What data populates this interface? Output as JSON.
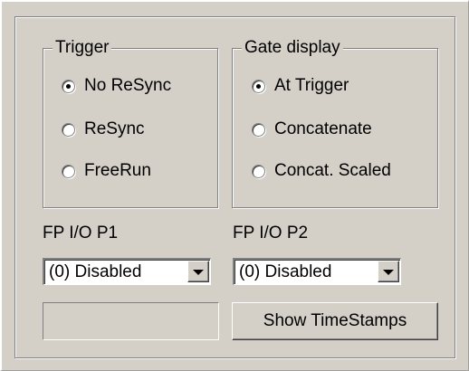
{
  "trigger": {
    "title": "Trigger",
    "options": [
      {
        "label": "No ReSync",
        "selected": true
      },
      {
        "label": "ReSync",
        "selected": false
      },
      {
        "label": "FreeRun",
        "selected": false
      }
    ]
  },
  "gate_display": {
    "title": "Gate display",
    "options": [
      {
        "label": "At Trigger",
        "selected": true
      },
      {
        "label": "Concatenate",
        "selected": false
      },
      {
        "label": "Concat. Scaled",
        "selected": false
      }
    ]
  },
  "fp_io_p1": {
    "label": "FP I/O P1",
    "value": "(0) Disabled"
  },
  "fp_io_p2": {
    "label": "FP I/O P2",
    "value": "(0) Disabled"
  },
  "buttons": {
    "show_timestamps": "Show TimeStamps"
  },
  "icons": {
    "radio_selected": "radio-selected-icon",
    "dropdown_arrow": "chevron-down-icon"
  },
  "colors": {
    "face": "#d4d0c8",
    "shadow": "#808080",
    "highlight": "#ffffff"
  }
}
